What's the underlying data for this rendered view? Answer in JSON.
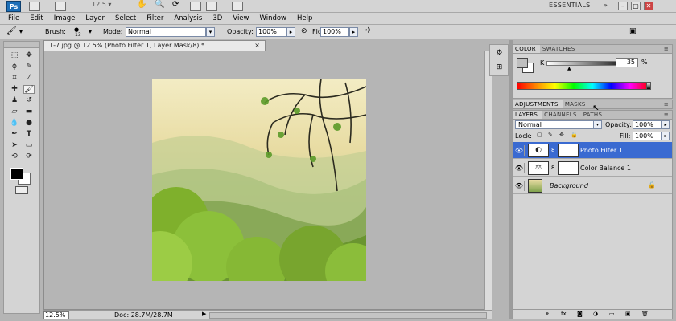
{
  "app": {
    "logo": "Ps",
    "zoom": "12.5",
    "workspace": "ESSENTIALS"
  },
  "window_controls": [
    "–",
    "▢",
    "✕"
  ],
  "menu": [
    "File",
    "Edit",
    "Image",
    "Layer",
    "Select",
    "Filter",
    "Analysis",
    "3D",
    "View",
    "Window",
    "Help"
  ],
  "options": {
    "brush_label": "Brush:",
    "brush_size": "13",
    "mode_label": "Mode:",
    "mode_value": "Normal",
    "opacity_label": "Opacity:",
    "opacity_value": "100%",
    "flow_label": "Flow:",
    "flow_value": "100%"
  },
  "document": {
    "tab_title": "1-7.jpg @ 12.5% (Photo Filter 1, Layer Mask/8) *",
    "close": "×"
  },
  "status": {
    "zoom": "12.5%",
    "doc": "Doc: 28.7M/28.7M",
    "arrow": "▶"
  },
  "color_panel": {
    "tabs": [
      "COLOR",
      "SWATCHES"
    ],
    "k_label": "K",
    "k_value": "35",
    "unit": "%"
  },
  "adjustments_panel": {
    "tabs": [
      "ADJUSTMENTS",
      "MASKS"
    ]
  },
  "layers_panel": {
    "tabs": [
      "LAYERS",
      "CHANNELS",
      "PATHS"
    ],
    "blend_mode": "Normal",
    "opacity_label": "Opacity:",
    "opacity_value": "100%",
    "lock_label": "Lock:",
    "fill_label": "Fill:",
    "fill_value": "100%",
    "layers": [
      {
        "name": "Photo Filter 1",
        "selected": true
      },
      {
        "name": "Color Balance 1",
        "selected": false
      },
      {
        "name": "Background",
        "selected": false
      }
    ]
  },
  "colors": {
    "selection": "#3a6ad1",
    "panel_bg": "#d4d4d4",
    "canvas_bg": "#b5b5b5"
  },
  "icons": [
    "move-icon",
    "marquee-icon",
    "lasso-icon",
    "crop-icon",
    "eyedropper-icon",
    "healing-icon",
    "brush-icon",
    "clone-stamp-icon",
    "eraser-icon",
    "gradient-icon",
    "dodge-icon",
    "pen-icon",
    "type-icon",
    "path-select-icon",
    "shape-icon",
    "3d-rotate-icon",
    "hand-icon",
    "zoom-icon",
    "eye-icon",
    "chain-icon",
    "lock-icon"
  ]
}
